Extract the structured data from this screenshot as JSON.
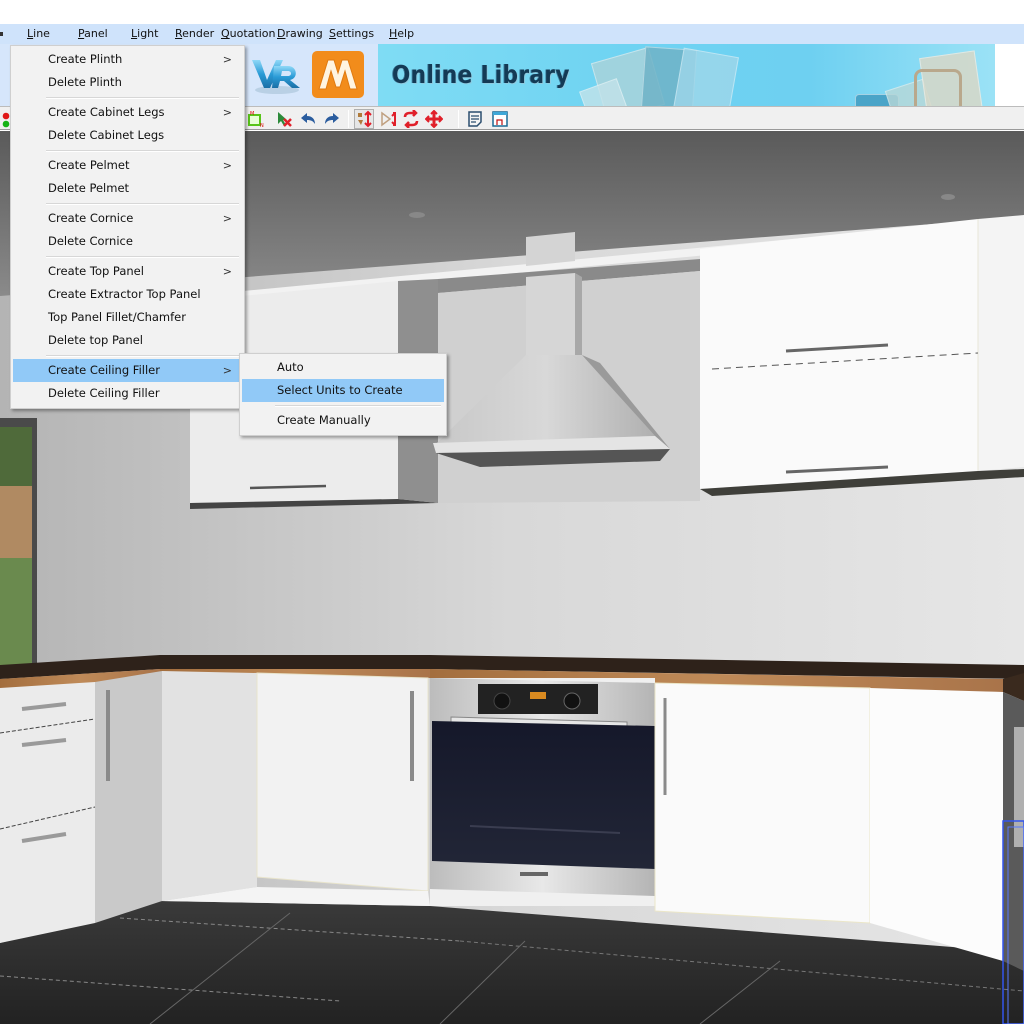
{
  "menubar": {
    "items": [
      {
        "label": "Line",
        "underline": "L"
      },
      {
        "label": "Panel",
        "underline": "P"
      },
      {
        "label": "Light",
        "underline": "L"
      },
      {
        "label": "Render",
        "underline": "R"
      },
      {
        "label": "Quotation",
        "underline": "Q"
      },
      {
        "label": "Drawing",
        "underline": "D"
      },
      {
        "label": "Settings",
        "underline": "S"
      },
      {
        "label": "Help",
        "underline": "H"
      }
    ]
  },
  "banner": {
    "vr_logo": "VR",
    "m_logo": "M",
    "online_library_title": "Online Library"
  },
  "toolbar": {
    "buttons": [
      {
        "name": "dimension-box-icon"
      },
      {
        "name": "delete-selection-icon"
      },
      {
        "name": "undo-icon"
      },
      {
        "name": "redo-icon"
      },
      {
        "name": "align-units-icon",
        "active": true
      },
      {
        "name": "mirror-icon"
      },
      {
        "name": "swap-icon"
      },
      {
        "name": "move-icon"
      },
      {
        "name": "notes-icon"
      },
      {
        "name": "drawing-view-icon"
      }
    ]
  },
  "main_menu": {
    "groups": [
      [
        {
          "label": "Create Plinth",
          "submenu": true
        },
        {
          "label": "Delete Plinth",
          "submenu": false
        }
      ],
      [
        {
          "label": "Create Cabinet Legs",
          "submenu": true
        },
        {
          "label": "Delete Cabinet Legs",
          "submenu": false
        }
      ],
      [
        {
          "label": "Create Pelmet",
          "submenu": true
        },
        {
          "label": "Delete Pelmet",
          "submenu": false
        }
      ],
      [
        {
          "label": "Create Cornice",
          "submenu": true
        },
        {
          "label": "Delete Cornice",
          "submenu": false
        }
      ],
      [
        {
          "label": "Create Top Panel",
          "submenu": true
        },
        {
          "label": "Create Extractor Top Panel",
          "submenu": false
        },
        {
          "label": "Top Panel Fillet/Chamfer",
          "submenu": false
        },
        {
          "label": "Delete top Panel",
          "submenu": false
        }
      ],
      [
        {
          "label": "Create Ceiling Filler",
          "submenu": true,
          "highlighted": true
        },
        {
          "label": "Delete Ceiling Filler",
          "submenu": false
        }
      ]
    ],
    "arrow_glyph": ">"
  },
  "sub_menu": {
    "items": [
      {
        "label": "Auto"
      },
      {
        "label": "Select Units to Create",
        "highlighted": true
      },
      {
        "separator": true
      },
      {
        "label": "Create Manually"
      }
    ]
  },
  "viewport": {
    "scene": "3D kitchen render",
    "colors": {
      "ceiling": "#5e5e5e",
      "wall": "#d4d4d4",
      "cabinet": "#f8f8f8",
      "worktop_edge": "#b07a48",
      "worktop_top": "#2e221a",
      "floor": "#2b2b2b",
      "highlight": "#91c9f7"
    }
  }
}
